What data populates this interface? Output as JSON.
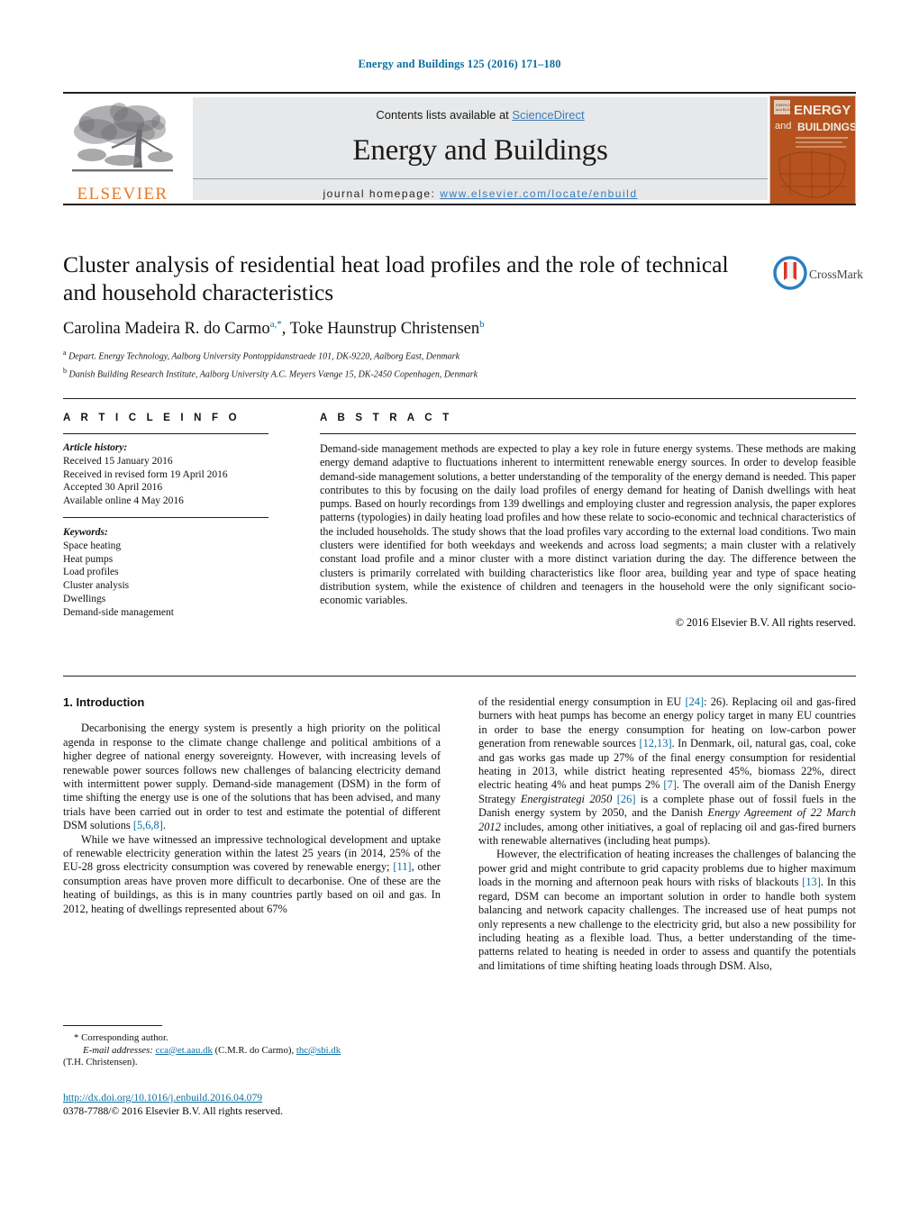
{
  "running_head": "Energy and Buildings 125 (2016) 171–180",
  "masthead": {
    "contents_prefix": "Contents lists available at ",
    "sciencedirect": "ScienceDirect",
    "journal_name": "Energy and Buildings",
    "homepage_prefix": "journal homepage: ",
    "homepage_url": "www.elsevier.com/locate/enbuild",
    "publisher_wordmark": "ELSEVIER",
    "cover_title_line1": "ENERGY",
    "cover_title_line2": "and",
    "cover_title_line3": "BUILDINGS",
    "colors": {
      "link": "#3a7cb8",
      "running_head": "#0b6ea0",
      "elsevier_orange": "#e87722",
      "band_gray": "#e7e8e9",
      "cover_orange": "#b5521e"
    }
  },
  "title_block": {
    "title": "Cluster analysis of residential heat load profiles and the role of technical and household characteristics",
    "author1": "Carolina Madeira R. do Carmo",
    "author1_marks": "a,",
    "author1_star": "*",
    "author_sep": ", ",
    "author2": "Toke Haunstrup Christensen",
    "author2_mark": "b",
    "affiliation_a_mark": "a",
    "affiliation_a": "Depart. Energy Technology, Aalborg University Pontoppidanstraede 101, DK-9220, Aalborg East, Denmark",
    "affiliation_b_mark": "b",
    "affiliation_b": "Danish Building Research Institute, Aalborg University A.C. Meyers Vænge 15, DK-2450 Copenhagen, Denmark",
    "crossmark_label": "CrossMark"
  },
  "article_info": {
    "heading": "A R T I C L E    I N F O",
    "history_label": "Article history:",
    "history": [
      "Received 15 January 2016",
      "Received in revised form 19 April 2016",
      "Accepted 30 April 2016",
      "Available online 4 May 2016"
    ],
    "keywords_label": "Keywords:",
    "keywords": [
      "Space heating",
      "Heat pumps",
      "Load profiles",
      "Cluster analysis",
      "Dwellings",
      "Demand-side management"
    ]
  },
  "abstract": {
    "heading": "A B S T R A C T",
    "text": "Demand-side management methods are expected to play a key role in future energy systems. These methods are making energy demand adaptive to fluctuations inherent to intermittent renewable energy sources. In order to develop feasible demand-side management solutions, a better understanding of the temporality of the energy demand is needed. This paper contributes to this by focusing on the daily load profiles of energy demand for heating of Danish dwellings with heat pumps. Based on hourly recordings from 139 dwellings and employing cluster and regression analysis, the paper explores patterns (typologies) in daily heating load profiles and how these relate to socio-economic and technical characteristics of the included households. The study shows that the load profiles vary according to the external load conditions. Two main clusters were identified for both weekdays and weekends and across load segments; a main cluster with a relatively constant load profile and a minor cluster with a more distinct variation during the day. The difference between the clusters is primarily correlated with building characteristics like floor area, building year and type of space heating distribution system, while the existence of children and teenagers in the household were the only significant socio-economic variables.",
    "copyright": "© 2016 Elsevier B.V. All rights reserved."
  },
  "body": {
    "section_heading": "1.  Introduction",
    "left_p1_a": "Decarbonising the energy system is presently a high priority on the political agenda in response to the climate change challenge and political ambitions of a higher degree of national energy sovereignty. However, with increasing levels of renewable power sources follows new challenges of balancing electricity demand with intermittent power supply. Demand-side management (DSM) in the form of time shifting the energy use is one of the solutions that has been advised, and many trials have been carried out in order to test and estimate the potential of different DSM solutions ",
    "left_p1_ref": "[5,6,8]",
    "left_p1_b": ".",
    "left_p2_a": "While we have witnessed an impressive technological development and uptake of renewable electricity generation within the latest 25 years (in 2014, 25% of the EU-28 gross electricity consumption was covered by renewable energy; ",
    "left_p2_ref": "[11]",
    "left_p2_b": ", other consumption areas have proven more difficult to decarbonise. One of these are the heating of buildings, as this is in many countries partly based on oil and gas. In 2012, heating of dwellings represented about 67%",
    "right_p1_a": "of the residential energy consumption in EU ",
    "right_p1_ref1": "[24]",
    "right_p1_b": ": 26). Replacing oil and gas-fired burners with heat pumps has become an energy policy target in many EU countries in order to base the energy consumption for heating on low-carbon power generation from renewable sources ",
    "right_p1_ref2": "[12,13]",
    "right_p1_c": ". In Denmark, oil, natural gas, coal, coke and gas works gas made up 27% of the final energy consumption for residential heating in 2013, while district heating represented 45%, biomass 22%, direct electric heating 4% and heat pumps 2% ",
    "right_p1_ref3": "[7]",
    "right_p1_d": ". The overall aim of the Danish Energy Strategy ",
    "right_p1_ital1": "Energistrategi 2050",
    "right_p1_e": " ",
    "right_p1_ref4": "[26]",
    "right_p1_f": " is a complete phase out of fossil fuels in the Danish energy system by 2050, and the Danish ",
    "right_p1_ital2": "Energy Agreement of 22 March 2012",
    "right_p1_g": " includes, among other initiatives, a goal of replacing oil and gas-fired burners with renewable alternatives (including heat pumps).",
    "right_p2_a": "However, the electrification of heating increases the challenges of balancing the power grid and might contribute to grid capacity problems due to higher maximum loads in the morning and afternoon peak hours with risks of blackouts ",
    "right_p2_ref": "[13]",
    "right_p2_b": ". In this regard, DSM can become an important solution in order to handle both system balancing and network capacity challenges. The increased use of heat pumps not only represents a new challenge to the electricity grid, but also a new possibility for including heating as a flexible load. Thus, a better understanding of the time-patterns related to heating is needed in order to assess and quantify the potentials and limitations of time shifting heating loads through DSM. Also,"
  },
  "footnotes": {
    "corresponding": "*  Corresponding author.",
    "email_label": "E-mail addresses:",
    "email1": "cca@et.aau.dk",
    "email1_owner": " (C.M.R. do Carmo), ",
    "email2": "thc@sbi.dk",
    "email2_owner": "(T.H. Christensen).",
    "doi_url": "http://dx.doi.org/10.1016/j.enbuild.2016.04.079",
    "issn_line": "0378-7788/© 2016 Elsevier B.V. All rights reserved."
  }
}
